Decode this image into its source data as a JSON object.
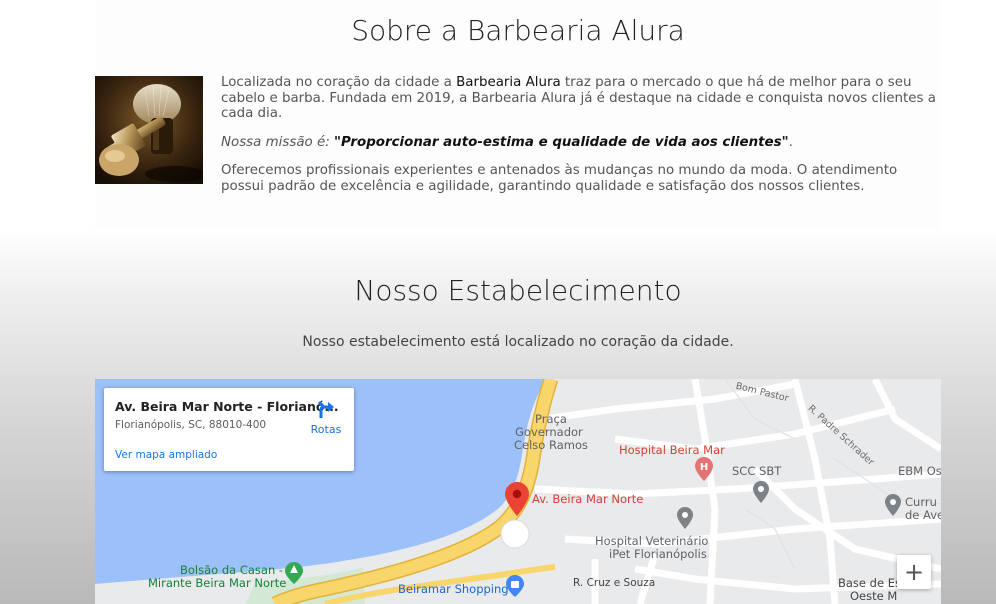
{
  "about": {
    "title": "Sobre a Barbearia Alura",
    "image_icon": "barber-shaving-kit-photo",
    "p1_pre": "Localizada no coração da cidade a ",
    "p1_strong": "Barbearia Alura",
    "p1_post": " traz para o mercado o que há de melhor para o seu cabelo e barba. Fundada em 2019, a Barbearia Alura já é destaque na cidade e conquista novos clientes a cada dia.",
    "mission_label": "Nossa missão é: ",
    "mission_quote": "\"Proporcionar auto-estima e qualidade de vida aos clientes\"",
    "mission_end": ".",
    "p3": "Oferecemos profissionais experientes e antenados às mudanças no mundo da moda. O atendimento possui padrão de excelência e agilidade, garantindo qualidade e satisfação dos nossos clientes."
  },
  "establishment": {
    "title": "Nosso Estabelecimento",
    "subtitle": "Nosso estabelecimento está localizado no coração da cidade."
  },
  "map": {
    "info_title": "Av. Beira Mar Norte - Florianó...",
    "info_address": "Florianópolis, SC, 88010-400",
    "directions_label": "Rotas",
    "bigger_map_link": "Ver mapa ampliado",
    "zoom_in_label": "+",
    "marker_label": "Av. Beira Mar Norte",
    "labels": {
      "praca": "Praça",
      "governador": "Governador",
      "celso": "Celso Ramos",
      "hospital": "Hospital Beira Mar",
      "scc": "SCC SBT",
      "ebm": "EBM Os",
      "curru": "Curru",
      "de_ave": "de Ave",
      "hospital_vet": "Hospital Veterinário",
      "ipet": "iPet Florianópolis",
      "bolsao": "Bolsão da Casan -",
      "mirante": "Mirante Beira Mar Norte",
      "beiramar_shopping": "Beiramar Shopping",
      "cruz_souza": "R. Cruz e Souza",
      "base": "Base de Es",
      "oeste": "Oeste M",
      "bom_pastor": "Bom Pastor",
      "padre_schrader": "R. Padre Schrader"
    },
    "colors": {
      "water": "#9cc0f9",
      "land": "#e9eaec",
      "highway": "#f8d66c",
      "marker": "#ea4335",
      "poi_gray": "#7d8287",
      "link_blue": "#1a73e8"
    }
  }
}
